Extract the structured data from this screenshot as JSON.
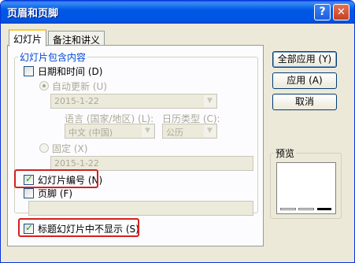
{
  "window": {
    "title": "页眉和页脚"
  },
  "title_buttons": {
    "help": "?",
    "close": "✕"
  },
  "tabs": [
    {
      "label": "幻灯片",
      "active": true
    },
    {
      "label": "备注和讲义",
      "active": false
    }
  ],
  "slide_content": {
    "group_label": "幻灯片包含内容",
    "date_time": {
      "label": "日期和时间 (D)",
      "checked": false
    },
    "auto_update": {
      "label": "自动更新 (U)",
      "selected": true,
      "value": "2015-1-22"
    },
    "language": {
      "label": "语言 (国家/地区) (L):",
      "value": "中文 (中国)"
    },
    "calendar": {
      "label": "日历类型 (C):",
      "value": "公历"
    },
    "fixed": {
      "label": "固定 (X)",
      "selected": false,
      "value": "2015-1-22"
    },
    "slide_number": {
      "label": "幻灯片编号 (N)",
      "checked": true
    },
    "footer": {
      "label": "页脚 (F)",
      "checked": false,
      "value": ""
    }
  },
  "dont_show_title": {
    "label": "标题幻灯片中不显示 (S)",
    "checked": true
  },
  "buttons": {
    "apply_all": "全部应用 (Y)",
    "apply": "应用 (A)",
    "cancel": "取消"
  },
  "preview": {
    "label": "预览"
  },
  "colors": {
    "titlebar": "#0054e3",
    "highlight": "#d42020",
    "check": "#21a121",
    "group_label": "#0046d5"
  }
}
